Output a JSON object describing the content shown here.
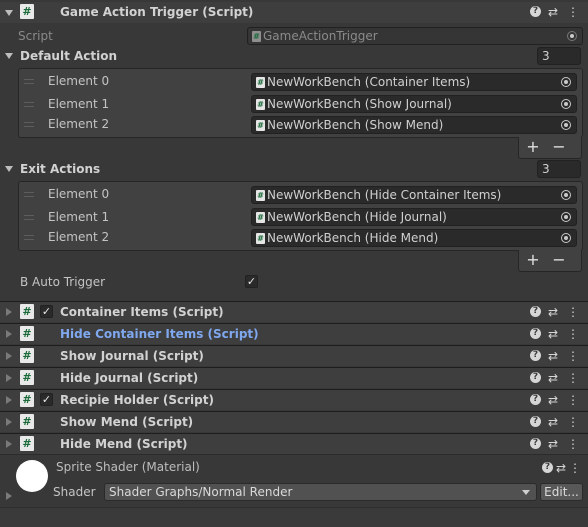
{
  "main_component": {
    "title": "Game Action Trigger (Script)",
    "script_label": "Script",
    "script_value": "GameActionTrigger",
    "default_action": {
      "label": "Default Action",
      "size": "3",
      "elements": [
        {
          "label": "Element 0",
          "value": "NewWorkBench (Container Items)"
        },
        {
          "label": "Element 1",
          "value": "NewWorkBench (Show Journal)"
        },
        {
          "label": "Element 2",
          "value": "NewWorkBench (Show Mend)"
        }
      ]
    },
    "exit_actions": {
      "label": "Exit Actions",
      "size": "3",
      "elements": [
        {
          "label": "Element 0",
          "value": "NewWorkBench (Hide Container Items)"
        },
        {
          "label": "Element 1",
          "value": "NewWorkBench (Hide Journal)"
        },
        {
          "label": "Element 2",
          "value": "NewWorkBench (Hide Mend)"
        }
      ]
    },
    "auto_trigger_label": "B Auto Trigger",
    "auto_trigger_checked": true,
    "add_label": "+",
    "remove_label": "−"
  },
  "components": [
    {
      "title": "Container Items (Script)",
      "enabled": true,
      "highlight": false
    },
    {
      "title": "Hide Container Items (Script)",
      "enabled": false,
      "highlight": true
    },
    {
      "title": "Show Journal (Script)",
      "enabled": false,
      "highlight": false
    },
    {
      "title": "Hide Journal (Script)",
      "enabled": false,
      "highlight": false
    },
    {
      "title": "Recipie Holder (Script)",
      "enabled": true,
      "highlight": false
    },
    {
      "title": "Show Mend (Script)",
      "enabled": false,
      "highlight": false
    },
    {
      "title": "Hide Mend (Script)",
      "enabled": false,
      "highlight": false
    }
  ],
  "material": {
    "title": "Sprite Shader (Material)",
    "shader_label": "Shader",
    "shader_value": "Shader Graphs/Normal Render",
    "edit_label": "Edit..."
  },
  "icons": {
    "script": "#",
    "check": "✓",
    "help": "?",
    "presets": "⇄",
    "more": "⋮"
  },
  "colors": {
    "highlight_title": "#7fa8ef",
    "panel_bg": "#383838",
    "header_bg": "#3e3e3e"
  }
}
